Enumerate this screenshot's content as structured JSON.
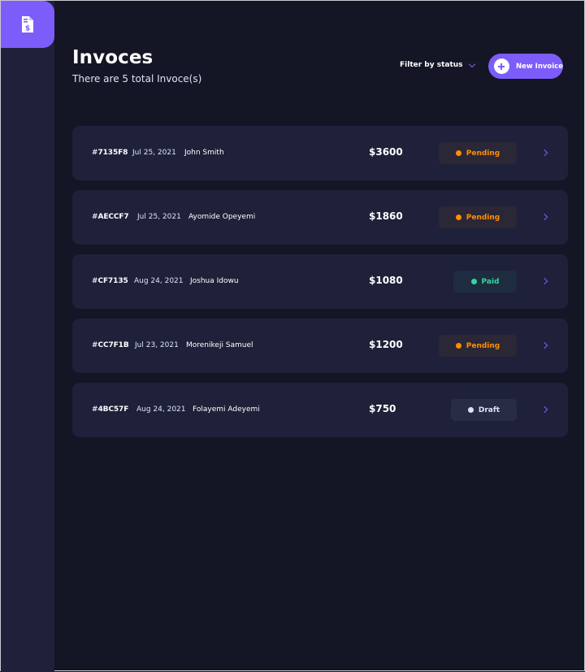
{
  "app": {
    "logo_icon": "invoice-dollar-icon",
    "accent_color": "#7c5dfa"
  },
  "header": {
    "title": "Invoces",
    "subtitle": "There are 5 total Invoce(s)",
    "filter_label": "Filter by status",
    "new_invoice_label": "New Invoice"
  },
  "invoices": [
    {
      "id_hash": "#",
      "id": "7135F8",
      "date": "Jul 25, 2021",
      "client": "John Smith",
      "amount": "$3600",
      "status": "Pending",
      "status_key": "pending"
    },
    {
      "id_hash": "#",
      "id": "AECCF7",
      "date": "Jul 25, 2021",
      "client": "Ayomide Opeyemi",
      "amount": "$1860",
      "status": "Pending",
      "status_key": "pending"
    },
    {
      "id_hash": "#",
      "id": "CF7135",
      "date": "Aug 24, 2021",
      "client": "Joshua Idowu",
      "amount": "$1080",
      "status": "Paid",
      "status_key": "paid"
    },
    {
      "id_hash": "#",
      "id": "CC7F1B",
      "date": "Jul 23, 2021",
      "client": "Morenikeji Samuel",
      "amount": "$1200",
      "status": "Pending",
      "status_key": "pending"
    },
    {
      "id_hash": "#",
      "id": "4BC57F",
      "date": "Aug 24, 2021",
      "client": "Folayemi Adeyemi",
      "amount": "$750",
      "status": "Draft",
      "status_key": "draft"
    }
  ],
  "status_colors": {
    "pending": "#ff8f00",
    "paid": "#33d69f",
    "draft": "#dfe3fa"
  }
}
